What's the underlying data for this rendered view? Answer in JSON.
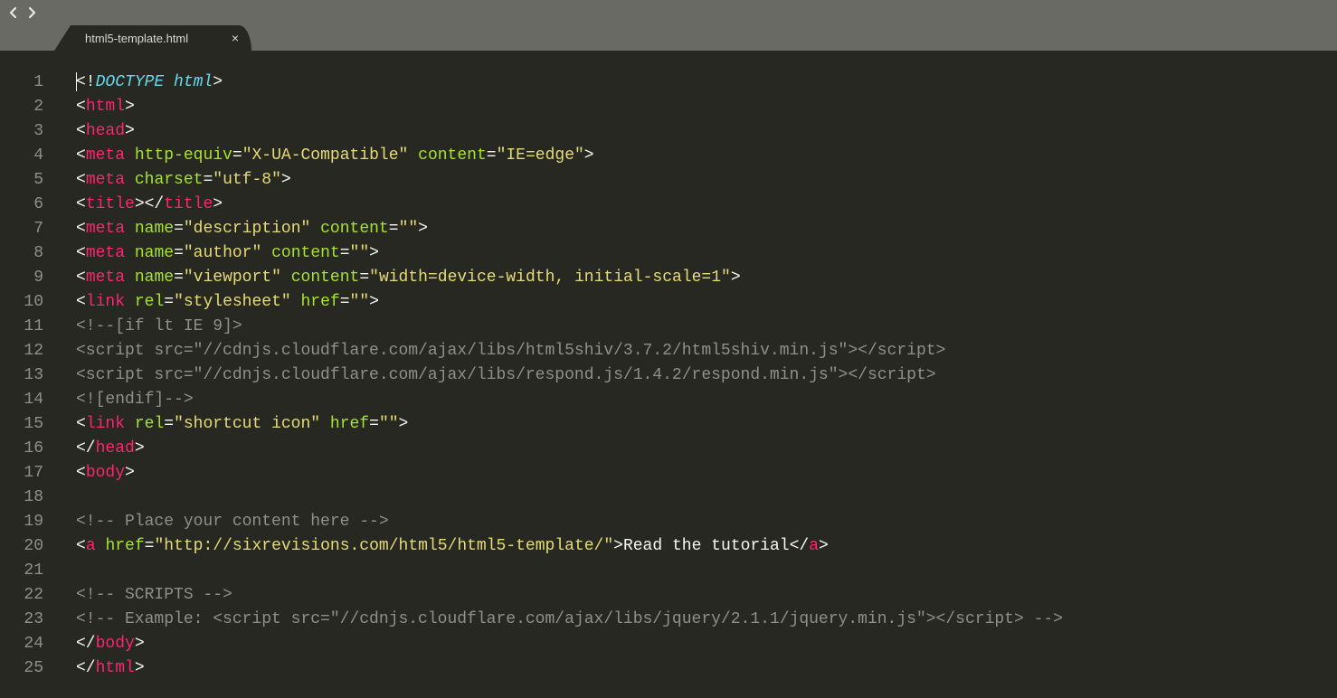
{
  "tab": {
    "name": "html5-template.html"
  },
  "gutter": [
    "1",
    "2",
    "3",
    "4",
    "5",
    "6",
    "7",
    "8",
    "9",
    "10",
    "11",
    "12",
    "13",
    "14",
    "15",
    "16",
    "17",
    "18",
    "19",
    "20",
    "21",
    "22",
    "23",
    "24",
    "25"
  ],
  "code": {
    "lines": [
      {
        "t": "doctype",
        "tokens": [
          {
            "c": "p",
            "t": "<!"
          },
          {
            "c": "doctype",
            "t": "DOCTYPE "
          },
          {
            "c": "doctype",
            "t": "html"
          },
          {
            "c": "p",
            "t": ">"
          }
        ],
        "cursor": true
      },
      {
        "tokens": [
          {
            "c": "p",
            "t": "<"
          },
          {
            "c": "kw",
            "t": "html"
          },
          {
            "c": "p",
            "t": ">"
          }
        ]
      },
      {
        "tokens": [
          {
            "c": "p",
            "t": "<"
          },
          {
            "c": "kw",
            "t": "head"
          },
          {
            "c": "p",
            "t": ">"
          }
        ]
      },
      {
        "tokens": [
          {
            "c": "p",
            "t": "<"
          },
          {
            "c": "kw",
            "t": "meta"
          },
          {
            "c": "p",
            "t": " "
          },
          {
            "c": "attr",
            "t": "http-equiv"
          },
          {
            "c": "p",
            "t": "="
          },
          {
            "c": "str",
            "t": "\"X-UA-Compatible\""
          },
          {
            "c": "p",
            "t": " "
          },
          {
            "c": "attr",
            "t": "content"
          },
          {
            "c": "p",
            "t": "="
          },
          {
            "c": "str",
            "t": "\"IE=edge\""
          },
          {
            "c": "p",
            "t": ">"
          }
        ]
      },
      {
        "tokens": [
          {
            "c": "p",
            "t": "<"
          },
          {
            "c": "kw",
            "t": "meta"
          },
          {
            "c": "p",
            "t": " "
          },
          {
            "c": "attr",
            "t": "charset"
          },
          {
            "c": "p",
            "t": "="
          },
          {
            "c": "str",
            "t": "\"utf-8\""
          },
          {
            "c": "p",
            "t": ">"
          }
        ]
      },
      {
        "tokens": [
          {
            "c": "p",
            "t": "<"
          },
          {
            "c": "kw",
            "t": "title"
          },
          {
            "c": "p",
            "t": "></"
          },
          {
            "c": "kw",
            "t": "title"
          },
          {
            "c": "p",
            "t": ">"
          }
        ]
      },
      {
        "tokens": [
          {
            "c": "p",
            "t": "<"
          },
          {
            "c": "kw",
            "t": "meta"
          },
          {
            "c": "p",
            "t": " "
          },
          {
            "c": "attr",
            "t": "name"
          },
          {
            "c": "p",
            "t": "="
          },
          {
            "c": "str",
            "t": "\"description\""
          },
          {
            "c": "p",
            "t": " "
          },
          {
            "c": "attr",
            "t": "content"
          },
          {
            "c": "p",
            "t": "="
          },
          {
            "c": "str",
            "t": "\"\""
          },
          {
            "c": "p",
            "t": ">"
          }
        ]
      },
      {
        "tokens": [
          {
            "c": "p",
            "t": "<"
          },
          {
            "c": "kw",
            "t": "meta"
          },
          {
            "c": "p",
            "t": " "
          },
          {
            "c": "attr",
            "t": "name"
          },
          {
            "c": "p",
            "t": "="
          },
          {
            "c": "str",
            "t": "\"author\""
          },
          {
            "c": "p",
            "t": " "
          },
          {
            "c": "attr",
            "t": "content"
          },
          {
            "c": "p",
            "t": "="
          },
          {
            "c": "str",
            "t": "\"\""
          },
          {
            "c": "p",
            "t": ">"
          }
        ]
      },
      {
        "tokens": [
          {
            "c": "p",
            "t": "<"
          },
          {
            "c": "kw",
            "t": "meta"
          },
          {
            "c": "p",
            "t": " "
          },
          {
            "c": "attr",
            "t": "name"
          },
          {
            "c": "p",
            "t": "="
          },
          {
            "c": "str",
            "t": "\"viewport\""
          },
          {
            "c": "p",
            "t": " "
          },
          {
            "c": "attr",
            "t": "content"
          },
          {
            "c": "p",
            "t": "="
          },
          {
            "c": "str",
            "t": "\"width=device-width, initial-scale=1\""
          },
          {
            "c": "p",
            "t": ">"
          }
        ]
      },
      {
        "tokens": [
          {
            "c": "p",
            "t": "<"
          },
          {
            "c": "kw",
            "t": "link"
          },
          {
            "c": "p",
            "t": " "
          },
          {
            "c": "attr",
            "t": "rel"
          },
          {
            "c": "p",
            "t": "="
          },
          {
            "c": "str",
            "t": "\"stylesheet\""
          },
          {
            "c": "p",
            "t": " "
          },
          {
            "c": "attr",
            "t": "href"
          },
          {
            "c": "p",
            "t": "="
          },
          {
            "c": "str",
            "t": "\"\""
          },
          {
            "c": "p",
            "t": ">"
          }
        ]
      },
      {
        "tokens": [
          {
            "c": "cm",
            "t": "<!--[if lt IE 9]>"
          }
        ]
      },
      {
        "tokens": [
          {
            "c": "cm",
            "t": "<script src=\"//cdnjs.cloudflare.com/ajax/libs/html5shiv/3.7.2/html5shiv.min.js\"></script>"
          }
        ]
      },
      {
        "tokens": [
          {
            "c": "cm",
            "t": "<script src=\"//cdnjs.cloudflare.com/ajax/libs/respond.js/1.4.2/respond.min.js\"></script>"
          }
        ]
      },
      {
        "tokens": [
          {
            "c": "cm",
            "t": "<![endif]-->"
          }
        ]
      },
      {
        "tokens": [
          {
            "c": "p",
            "t": "<"
          },
          {
            "c": "kw",
            "t": "link"
          },
          {
            "c": "p",
            "t": " "
          },
          {
            "c": "attr",
            "t": "rel"
          },
          {
            "c": "p",
            "t": "="
          },
          {
            "c": "str",
            "t": "\"shortcut icon\""
          },
          {
            "c": "p",
            "t": " "
          },
          {
            "c": "attr",
            "t": "href"
          },
          {
            "c": "p",
            "t": "="
          },
          {
            "c": "str",
            "t": "\"\""
          },
          {
            "c": "p",
            "t": ">"
          }
        ]
      },
      {
        "tokens": [
          {
            "c": "p",
            "t": "</"
          },
          {
            "c": "kw",
            "t": "head"
          },
          {
            "c": "p",
            "t": ">"
          }
        ]
      },
      {
        "tokens": [
          {
            "c": "p",
            "t": "<"
          },
          {
            "c": "kw",
            "t": "body"
          },
          {
            "c": "p",
            "t": ">"
          }
        ]
      },
      {
        "tokens": []
      },
      {
        "tokens": [
          {
            "c": "cm",
            "t": "<!-- Place your content here -->"
          }
        ]
      },
      {
        "tokens": [
          {
            "c": "p",
            "t": "<"
          },
          {
            "c": "kw",
            "t": "a"
          },
          {
            "c": "p",
            "t": " "
          },
          {
            "c": "attr",
            "t": "href"
          },
          {
            "c": "p",
            "t": "="
          },
          {
            "c": "str",
            "t": "\"http://sixrevisions.com/html5/html5-template/\""
          },
          {
            "c": "p",
            "t": ">Read the tutorial</"
          },
          {
            "c": "kw",
            "t": "a"
          },
          {
            "c": "p",
            "t": ">"
          }
        ]
      },
      {
        "tokens": []
      },
      {
        "tokens": [
          {
            "c": "cm",
            "t": "<!-- SCRIPTS -->"
          }
        ]
      },
      {
        "tokens": [
          {
            "c": "cm",
            "t": "<!-- Example: <script src=\"//cdnjs.cloudflare.com/ajax/libs/jquery/2.1.1/jquery.min.js\"></script> -->"
          }
        ]
      },
      {
        "tokens": [
          {
            "c": "p",
            "t": "</"
          },
          {
            "c": "kw",
            "t": "body"
          },
          {
            "c": "p",
            "t": ">"
          }
        ]
      },
      {
        "tokens": [
          {
            "c": "p",
            "t": "</"
          },
          {
            "c": "kw",
            "t": "html"
          },
          {
            "c": "p",
            "t": ">"
          }
        ]
      }
    ]
  }
}
